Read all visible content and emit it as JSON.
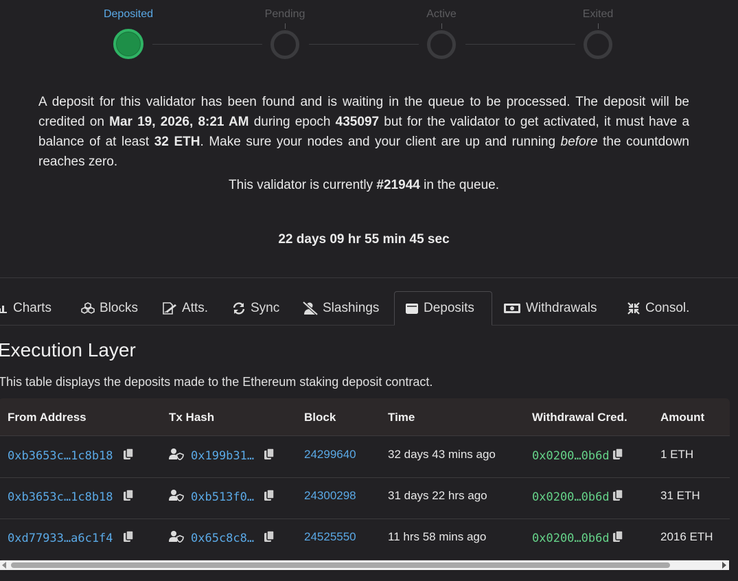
{
  "stepper": {
    "steps": [
      {
        "label": "Deposited"
      },
      {
        "label": "Pending"
      },
      {
        "label": "Active"
      },
      {
        "label": "Exited"
      }
    ],
    "current_step": "Deposited"
  },
  "description": {
    "p1": "A deposit for this validator has been found and is waiting in the queue to be processed. The deposit will be credited on ",
    "date": "Mar 19, 2026, 8:21 AM",
    "p2": " during epoch ",
    "epoch": "435097",
    "p3": " but for the validator to get activated, it must have a balance of at least ",
    "balance": "32 ETH",
    "p4": ". Make sure your nodes and your client are up and running ",
    "em": "before",
    "p5": " the countdown reaches zero."
  },
  "queue": {
    "prefix": "This validator is currently ",
    "position": "#21944",
    "suffix": " in the queue."
  },
  "countdown": "22 days 09 hr 55 min 45 sec",
  "tabs": [
    {
      "label": "Charts",
      "icon": "chart-bar-icon"
    },
    {
      "label": "Blocks",
      "icon": "cubes-icon"
    },
    {
      "label": "Atts.",
      "icon": "file-signature-icon"
    },
    {
      "label": "Sync",
      "icon": "sync-icon"
    },
    {
      "label": "Slashings",
      "icon": "user-slash-icon"
    },
    {
      "label": "Deposits",
      "icon": "wallet-icon"
    },
    {
      "label": "Withdrawals",
      "icon": "money-bill-icon"
    },
    {
      "label": "Consol.",
      "icon": "compress-icon"
    }
  ],
  "active_tab": "Deposits",
  "section": {
    "title": "Execution Layer",
    "description": "This table displays the deposits made to the Ethereum staking deposit contract."
  },
  "table": {
    "headers": {
      "from": "From Address",
      "tx": "Tx Hash",
      "block": "Block",
      "time": "Time",
      "cred": "Withdrawal Cred.",
      "amount": "Amount"
    },
    "rows": [
      {
        "from": "0xb3653c…1c8b18",
        "tx": "0x199b31…",
        "block": "24299640",
        "time": "32 days 43 mins ago",
        "cred": "0x0200…0b6d",
        "amount": "1 ETH"
      },
      {
        "from": "0xb3653c…1c8b18",
        "tx": "0xb513f0…",
        "block": "24300298",
        "time": "31 days 22 hrs ago",
        "cred": "0x0200…0b6d",
        "amount": "31 ETH"
      },
      {
        "from": "0xd77933…a6c1f4",
        "tx": "0x65c8c8…",
        "block": "24525550",
        "time": "11 hrs 58 mins ago",
        "cred": "0x0200…0b6d",
        "amount": "2016 ETH"
      }
    ]
  },
  "colors": {
    "background": "#222124",
    "link": "#5aa9e6",
    "credential": "#65d389",
    "deposited": "#1e8f48"
  }
}
